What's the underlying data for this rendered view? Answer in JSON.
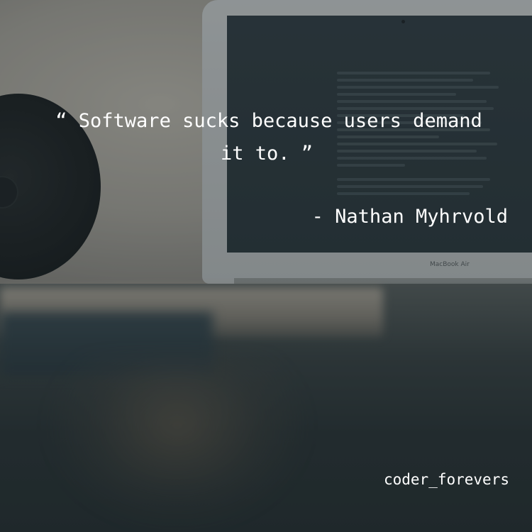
{
  "quote": {
    "line1": "“ Software sucks because users demand",
    "line2": "it to. ”"
  },
  "author": "- Nathan Myhrvold",
  "handle": "coder_forevers",
  "photo": {
    "laptop_brand": "MacBook Air"
  },
  "colors": {
    "text": "#ffffff",
    "overlay": "#141c20",
    "screen": "#2f3c42"
  }
}
